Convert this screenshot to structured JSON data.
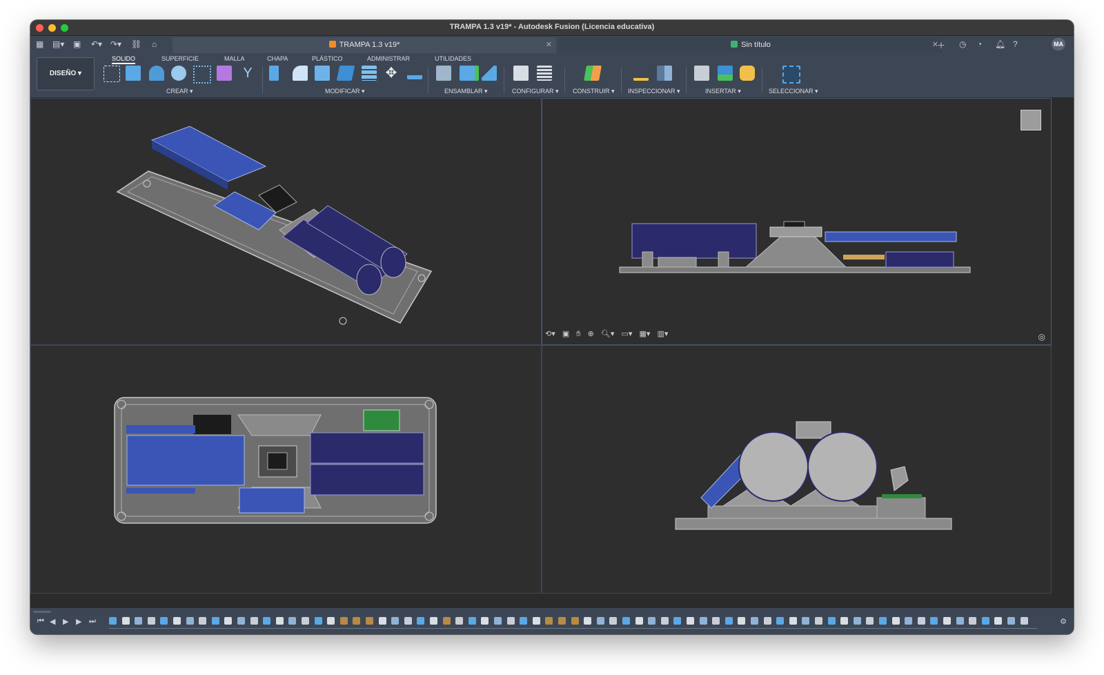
{
  "window": {
    "title": "TRAMPA 1.3 v19* - Autodesk Fusion (Licencia educativa)"
  },
  "tabs": [
    {
      "label": "TRAMPA 1.3 v19*",
      "active": true,
      "icon": "box-icon",
      "color": "#f28c28"
    },
    {
      "label": "Sin título",
      "active": false,
      "icon": "design-icon",
      "color": "#3cb371"
    }
  ],
  "tabbar": {
    "left_icons": [
      "grid-icon",
      "file-icon",
      "save-icon",
      "undo-icon",
      "redo-icon",
      "link-icon",
      "home-icon"
    ],
    "right_icons": [
      "plus-icon",
      "clock-icon",
      "history-icon",
      "bell-icon",
      "help-icon"
    ],
    "avatar": "MA"
  },
  "toolbar": {
    "workspace": "DISEÑO",
    "categories": [
      {
        "label": "SOLIDO",
        "active": true
      },
      {
        "label": "SUPERFICIE",
        "active": false
      },
      {
        "label": "MALLA",
        "active": false
      },
      {
        "label": "CHAPA",
        "active": false
      },
      {
        "label": "PLÁSTICO",
        "active": false
      },
      {
        "label": "ADMINISTRAR",
        "active": false
      },
      {
        "label": "UTILIDADES",
        "active": false
      }
    ],
    "groups": [
      {
        "label": "CREAR"
      },
      {
        "label": "MODIFICAR"
      },
      {
        "label": "ENSAMBLAR"
      },
      {
        "label": "CONFIGURAR"
      },
      {
        "label": "CONSTRUIR"
      },
      {
        "label": "INSPECCIONAR"
      },
      {
        "label": "INSERTAR"
      },
      {
        "label": "SELECCIONAR"
      }
    ]
  },
  "viewports": [
    {
      "name": "iso",
      "label": "viewport-isometric"
    },
    {
      "name": "front",
      "label": "viewport-front"
    },
    {
      "name": "top",
      "label": "viewport-top"
    },
    {
      "name": "right",
      "label": "viewport-right"
    }
  ],
  "navbar": {
    "icons": [
      "orbit-icon",
      "look-at-icon",
      "pan-icon",
      "zoom-window-icon",
      "zoom-icon",
      "display-settings-icon",
      "grid-icon",
      "viewports-icon"
    ]
  },
  "timeline": {
    "controls": [
      "first-icon",
      "previous-icon",
      "play-icon",
      "next-icon",
      "last-icon"
    ],
    "item_count": 72
  },
  "colors": {
    "accent": "#2f5fbf",
    "battery": "#2b2a6b",
    "model_gray": "#7e7e7e",
    "pcb_green": "#2e8b3e",
    "tan": "#d1a35a"
  }
}
